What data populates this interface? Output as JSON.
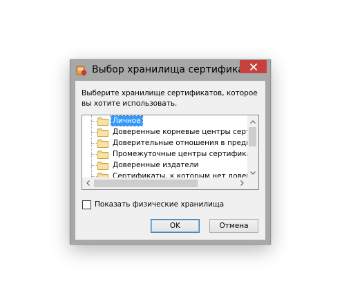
{
  "dialog": {
    "title": "Выбор хранилища сертификата",
    "prompt": "Выберите хранилище сертификатов, которое вы хотите использовать.",
    "close_icon": "close-icon",
    "app_icon": "certificate-app-icon"
  },
  "tree": {
    "items": [
      {
        "label": "Личное",
        "selected": true,
        "icon": "folder-icon"
      },
      {
        "label": "Доверенные корневые центры сертификации",
        "selected": false,
        "icon": "folder-icon"
      },
      {
        "label": "Доверительные отношения в предприятии",
        "selected": false,
        "icon": "folder-icon"
      },
      {
        "label": "Промежуточные центры сертификации",
        "selected": false,
        "icon": "folder-icon"
      },
      {
        "label": "Доверенные издатели",
        "selected": false,
        "icon": "folder-icon"
      },
      {
        "label": "Сертификаты, к которым нет доверия",
        "selected": false,
        "icon": "folder-icon"
      }
    ]
  },
  "checkbox": {
    "label": "Показать физические хранилища",
    "checked": false
  },
  "buttons": {
    "ok": "OK",
    "cancel": "Отмена"
  },
  "colors": {
    "selection": "#3399ff",
    "close_button": "#c7413c",
    "folder": "#f2d382"
  }
}
